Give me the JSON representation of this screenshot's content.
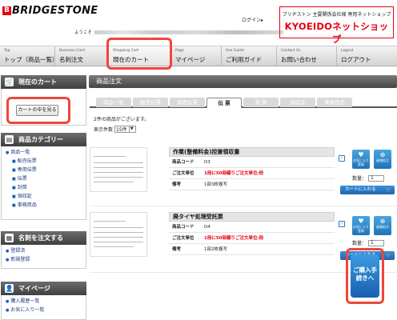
{
  "header": {
    "logo": "BRIDGESTONE",
    "login_link": "ログイン▸",
    "welcome": "ようこそ",
    "shop_sub": "ブリヂストン 主要関係会社様 専用ネットショップ",
    "shop_main": "KYOEIDOネットショップ"
  },
  "nav": [
    {
      "en": "Top",
      "jp": "トップ（商品一覧）"
    },
    {
      "en": "Business Card",
      "jp": "名刺注文"
    },
    {
      "en": "Shopping Cart",
      "jp": "現在のカート"
    },
    {
      "en": "Page",
      "jp": "マイページ"
    },
    {
      "en": "Use Guide",
      "jp": "ご利用ガイド"
    },
    {
      "en": "Contact Us",
      "jp": "お問い合わせ"
    },
    {
      "en": "Logout",
      "jp": "ログアウト"
    }
  ],
  "sidebar": {
    "cart_title": "現在のカート",
    "cart_button": "カートの中を見る",
    "category_title": "商品カテゴリー",
    "categories": [
      {
        "label": "商品一覧",
        "sub": false
      },
      {
        "label": "販売伝票",
        "sub": true
      },
      {
        "label": "専用伝票",
        "sub": true
      },
      {
        "label": "伝票",
        "sub": true
      },
      {
        "label": "封筒",
        "sub": true
      },
      {
        "label": "領収証",
        "sub": true
      },
      {
        "label": "事務用品",
        "sub": true
      }
    ],
    "namecard_title": "名刺を注文する",
    "namecard_links": [
      "登録済",
      "新規登録"
    ],
    "mypage_title": "マイページ",
    "mypage_links": [
      "購入履歴一覧",
      "お気に入り一覧"
    ]
  },
  "main": {
    "title": "商品注文",
    "tabs": [
      "商品一覧",
      "販売伝票",
      "専用伝票",
      "伝 票",
      "封 筒",
      "領収証",
      "事務用品"
    ],
    "active_tab": 3,
    "count_text": "2件の商品がございます。",
    "per_page_label": "表示件数",
    "per_page_value": "15件"
  },
  "products": [
    {
      "name": "作業(整備料金)控兼領収書",
      "code_label": "商品コード",
      "code": "D3",
      "unit_label": "ご注文単位",
      "unit": "1冊に50部綴りご注文単位:冊",
      "note_label": "備考",
      "note": "1部3枚複写",
      "qty_label": "数量：",
      "qty": "1",
      "cart_label": "カートに入れる",
      "icon1": "お気に入り登録",
      "icon2": "画像拡大"
    },
    {
      "name": "廃タイヤ処理受託票",
      "code_label": "商品コード",
      "code": "D4",
      "unit_label": "ご注文単位",
      "unit": "1冊に50部綴りご注文単位:冊",
      "note_label": "備考",
      "note": "1部2枚複写",
      "qty_label": "数量：",
      "qty": "1",
      "cart_label": "カートに入れる",
      "icon1": "お気に入り登録",
      "icon2": "画像拡大"
    }
  ],
  "checkout_label": "ご購入手続きへ",
  "colors": {
    "brand_red": "#e60012",
    "accent_blue": "#1f73b8",
    "highlight": "#f0453a"
  }
}
